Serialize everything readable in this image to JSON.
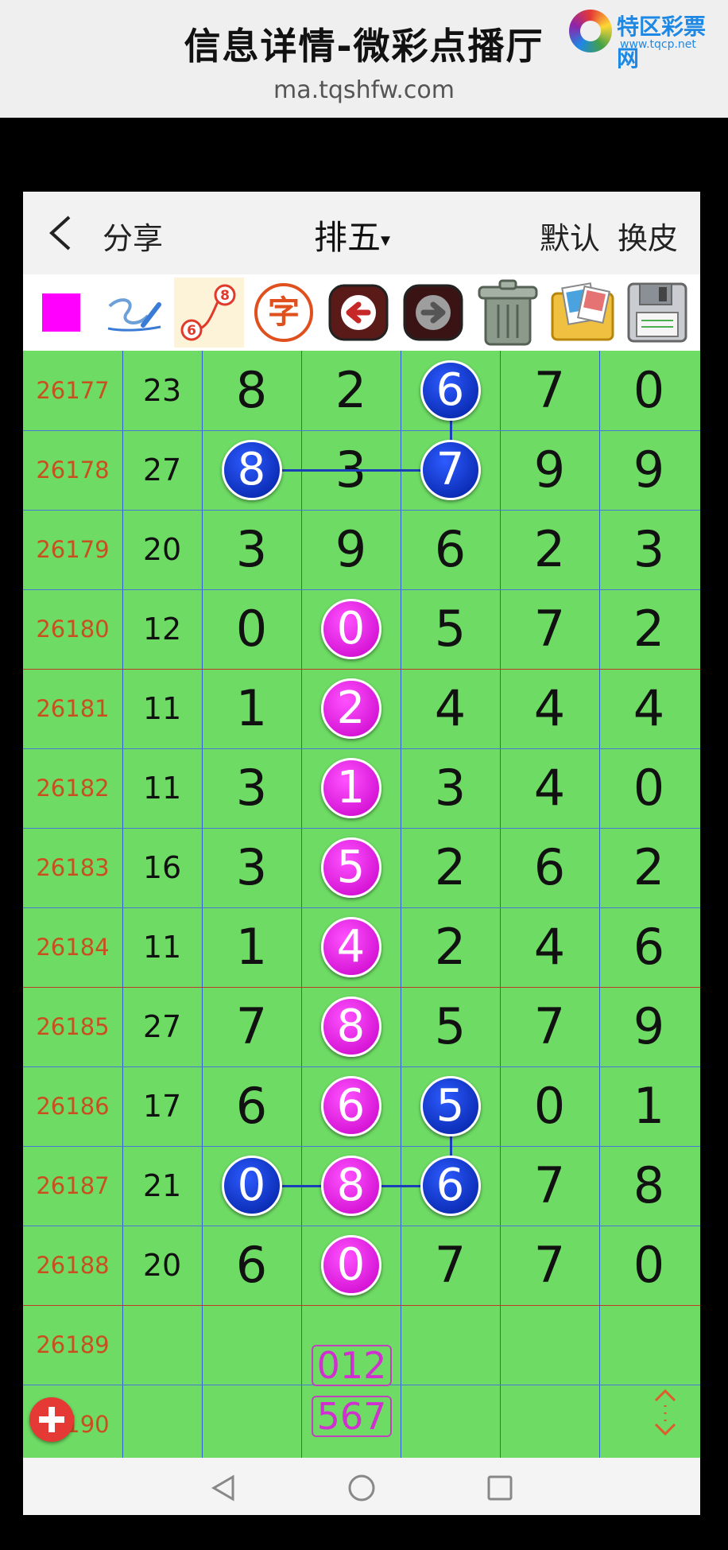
{
  "banner": {
    "title": "信息详情-微彩点播厅",
    "url": "ma.tqshfw.com"
  },
  "logo": {
    "name": "特区彩票网",
    "url": "www.tqcp.net"
  },
  "topbar": {
    "back_icon": "chevron-left-icon",
    "share_label": "分享",
    "title": "排五",
    "title_caret": "▾",
    "default_label": "默认",
    "skin_label": "换皮"
  },
  "toolbar": {
    "items": [
      "color-square-icon",
      "signature-pen-icon",
      "numbered-path-icon",
      "zi-character-icon",
      "arrow-left-icon",
      "arrow-right-icon",
      "trash-bin-icon",
      "photo-folder-icon",
      "floppy-disk-icon"
    ],
    "badge_text": "字",
    "path_numbers": [
      "8",
      "6"
    ],
    "accent_color": "#ff00ff"
  },
  "rows": [
    {
      "issue": "26177",
      "sum": "23",
      "digits": [
        "8",
        "2",
        "6",
        "7",
        "0"
      ]
    },
    {
      "issue": "26178",
      "sum": "27",
      "digits": [
        "8",
        "3",
        "7",
        "9",
        "9"
      ]
    },
    {
      "issue": "26179",
      "sum": "20",
      "digits": [
        "3",
        "9",
        "6",
        "2",
        "3"
      ]
    },
    {
      "issue": "26180",
      "sum": "12",
      "digits": [
        "0",
        "0",
        "5",
        "7",
        "2"
      ]
    },
    {
      "issue": "26181",
      "sum": "11",
      "digits": [
        "1",
        "2",
        "4",
        "4",
        "4"
      ]
    },
    {
      "issue": "26182",
      "sum": "11",
      "digits": [
        "3",
        "1",
        "3",
        "4",
        "0"
      ]
    },
    {
      "issue": "26183",
      "sum": "16",
      "digits": [
        "3",
        "5",
        "2",
        "6",
        "2"
      ]
    },
    {
      "issue": "26184",
      "sum": "11",
      "digits": [
        "1",
        "4",
        "2",
        "4",
        "6"
      ]
    },
    {
      "issue": "26185",
      "sum": "27",
      "digits": [
        "7",
        "8",
        "5",
        "7",
        "9"
      ]
    },
    {
      "issue": "26186",
      "sum": "17",
      "digits": [
        "6",
        "6",
        "5",
        "0",
        "1"
      ]
    },
    {
      "issue": "26187",
      "sum": "21",
      "digits": [
        "0",
        "8",
        "6",
        "7",
        "8"
      ]
    },
    {
      "issue": "26188",
      "sum": "20",
      "digits": [
        "6",
        "0",
        "7",
        "7",
        "0"
      ]
    },
    {
      "issue": "26189",
      "sum": "",
      "digits": [
        "",
        "",
        "",
        "",
        ""
      ]
    },
    {
      "issue": "26190",
      "sum": "",
      "digits": [
        "",
        "",
        "",
        "",
        ""
      ]
    }
  ],
  "highlights": [
    {
      "row": 0,
      "col": 2,
      "color": "blue"
    },
    {
      "row": 1,
      "col": 0,
      "color": "blue"
    },
    {
      "row": 1,
      "col": 2,
      "color": "blue"
    },
    {
      "row": 3,
      "col": 1,
      "color": "pink"
    },
    {
      "row": 4,
      "col": 1,
      "color": "pink"
    },
    {
      "row": 5,
      "col": 1,
      "color": "pink"
    },
    {
      "row": 6,
      "col": 1,
      "color": "pink"
    },
    {
      "row": 7,
      "col": 1,
      "color": "pink"
    },
    {
      "row": 8,
      "col": 1,
      "color": "pink"
    },
    {
      "row": 9,
      "col": 1,
      "color": "pink"
    },
    {
      "row": 9,
      "col": 2,
      "color": "blue"
    },
    {
      "row": 10,
      "col": 0,
      "color": "blue"
    },
    {
      "row": 10,
      "col": 1,
      "color": "pink"
    },
    {
      "row": 10,
      "col": 2,
      "color": "blue"
    },
    {
      "row": 11,
      "col": 1,
      "color": "pink"
    }
  ],
  "prediction": {
    "line1": "012",
    "line2": "567"
  },
  "colors": {
    "grid_bg": "#6edc64",
    "issue_text": "#c8501e",
    "blue_ball": "#0a2fd6",
    "pink_ball": "#e81ee8",
    "red_divider": "#c0392b"
  },
  "floating": {
    "add_icon": "plus-circle-icon",
    "scroll_icon": "up-down-arrows-icon"
  },
  "navbar": {
    "items": [
      "back-triangle-icon",
      "home-circle-icon",
      "recents-square-icon"
    ]
  }
}
